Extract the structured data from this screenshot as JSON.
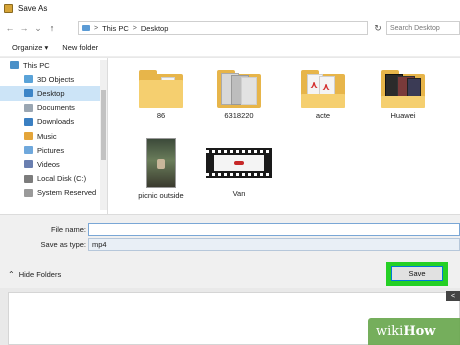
{
  "window": {
    "title": "Save As"
  },
  "nav": {
    "back": "←",
    "forward": "→",
    "recent": "⌄",
    "up": "↑",
    "refresh": "↻"
  },
  "address": {
    "crumbs": [
      "This PC",
      "Desktop"
    ],
    "separator": ">"
  },
  "search": {
    "placeholder": "Search Desktop"
  },
  "toolbar": {
    "organize": "Organize ▾",
    "new_folder": "New folder"
  },
  "sidebar": {
    "items": [
      {
        "label": "This PC",
        "icon": "computer-icon"
      },
      {
        "label": "3D Objects",
        "icon": "cube-icon"
      },
      {
        "label": "Desktop",
        "icon": "desktop-icon",
        "selected": true
      },
      {
        "label": "Documents",
        "icon": "documents-icon"
      },
      {
        "label": "Downloads",
        "icon": "download-icon"
      },
      {
        "label": "Music",
        "icon": "music-icon"
      },
      {
        "label": "Pictures",
        "icon": "pictures-icon"
      },
      {
        "label": "Videos",
        "icon": "videos-icon"
      },
      {
        "label": "Local Disk (C:)",
        "icon": "drive-icon"
      },
      {
        "label": "System Reserved",
        "icon": "drive-icon"
      }
    ]
  },
  "files": [
    {
      "label": "86",
      "type": "folder"
    },
    {
      "label": "6318220",
      "type": "folder"
    },
    {
      "label": "acte",
      "type": "folder"
    },
    {
      "label": "Huawei",
      "type": "folder"
    },
    {
      "label": "picnic outside",
      "type": "image"
    },
    {
      "label": "Van",
      "type": "video"
    }
  ],
  "form": {
    "file_name_label": "File name:",
    "file_name_value": "",
    "save_as_type_label": "Save as type:",
    "save_as_type_value": "mp4"
  },
  "footer": {
    "hide_folders": "Hide Folders",
    "save": "Save"
  },
  "watermark": {
    "prefix": "wiki",
    "suffix": "How"
  },
  "colors": {
    "highlight": "#25d025",
    "selected": "#cce4f7",
    "folder": "#e7b54a"
  }
}
